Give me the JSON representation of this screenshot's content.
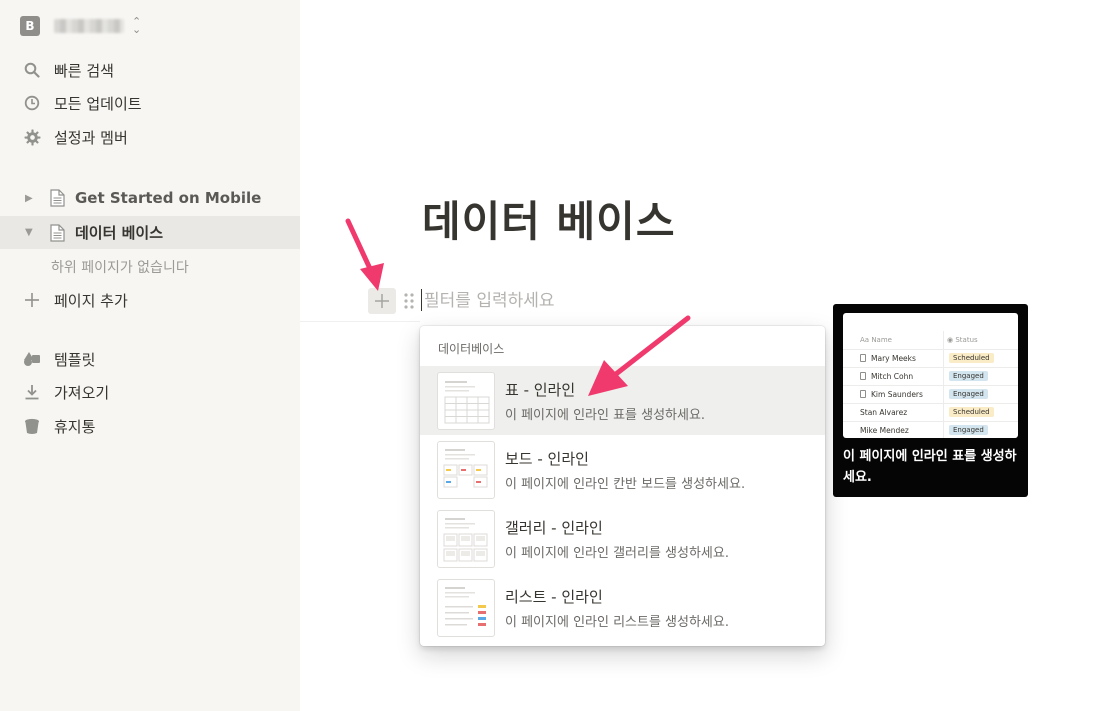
{
  "sidebar": {
    "workspace_initial": "B",
    "top_items": [
      {
        "label": "빠른 검색",
        "icon": "search-icon"
      },
      {
        "label": "모든 업데이트",
        "icon": "clock-icon"
      },
      {
        "label": "설정과 멤버",
        "icon": "gear-icon"
      }
    ],
    "pages": [
      {
        "label": "Get Started on Mobile",
        "icon": "page-icon",
        "expanded": false
      },
      {
        "label": "데이터 베이스",
        "icon": "page-icon",
        "expanded": true
      }
    ],
    "no_subpages": "하위 페이지가 없습니다",
    "add_page": "페이지 추가",
    "bottom_items": [
      {
        "label": "템플릿",
        "icon": "shapes-icon"
      },
      {
        "label": "가져오기",
        "icon": "download-icon"
      },
      {
        "label": "휴지통",
        "icon": "trash-icon"
      }
    ]
  },
  "main": {
    "page_title": "데이터 베이스",
    "filter_placeholder": "필터를 입력하세요"
  },
  "menu": {
    "header": "데이터베이스",
    "items": [
      {
        "title": "표 - 인라인",
        "desc": "이 페이지에 인라인 표를 생성하세요.",
        "selected": true
      },
      {
        "title": "보드 - 인라인",
        "desc": "이 페이지에 인라인 칸반 보드를 생성하세요.",
        "selected": false
      },
      {
        "title": "갤러리 - 인라인",
        "desc": "이 페이지에 인라인 갤러리를 생성하세요.",
        "selected": false
      },
      {
        "title": "리스트 - 인라인",
        "desc": "이 페이지에 인라인 리스트를 생성하세요.",
        "selected": false
      }
    ]
  },
  "preview": {
    "col_name": "Name",
    "col_status": "Status",
    "rows": [
      {
        "name": "Mary Meeks",
        "status": "Scheduled"
      },
      {
        "name": "Mitch Cohn",
        "status": "Engaged"
      },
      {
        "name": "Kim Saunders",
        "status": "Engaged"
      },
      {
        "name": "Stan Alvarez",
        "status": "Scheduled"
      },
      {
        "name": "Mike Mendez",
        "status": "Engaged"
      }
    ],
    "caption": "이 페이지에 인라인 표를 생성하세요."
  },
  "colors": {
    "sidebar_bg": "#f7f6f3",
    "accent_arrow": "#f0396c",
    "tag_scheduled": "#fbecc8",
    "tag_engaged": "#d3e5ef"
  }
}
